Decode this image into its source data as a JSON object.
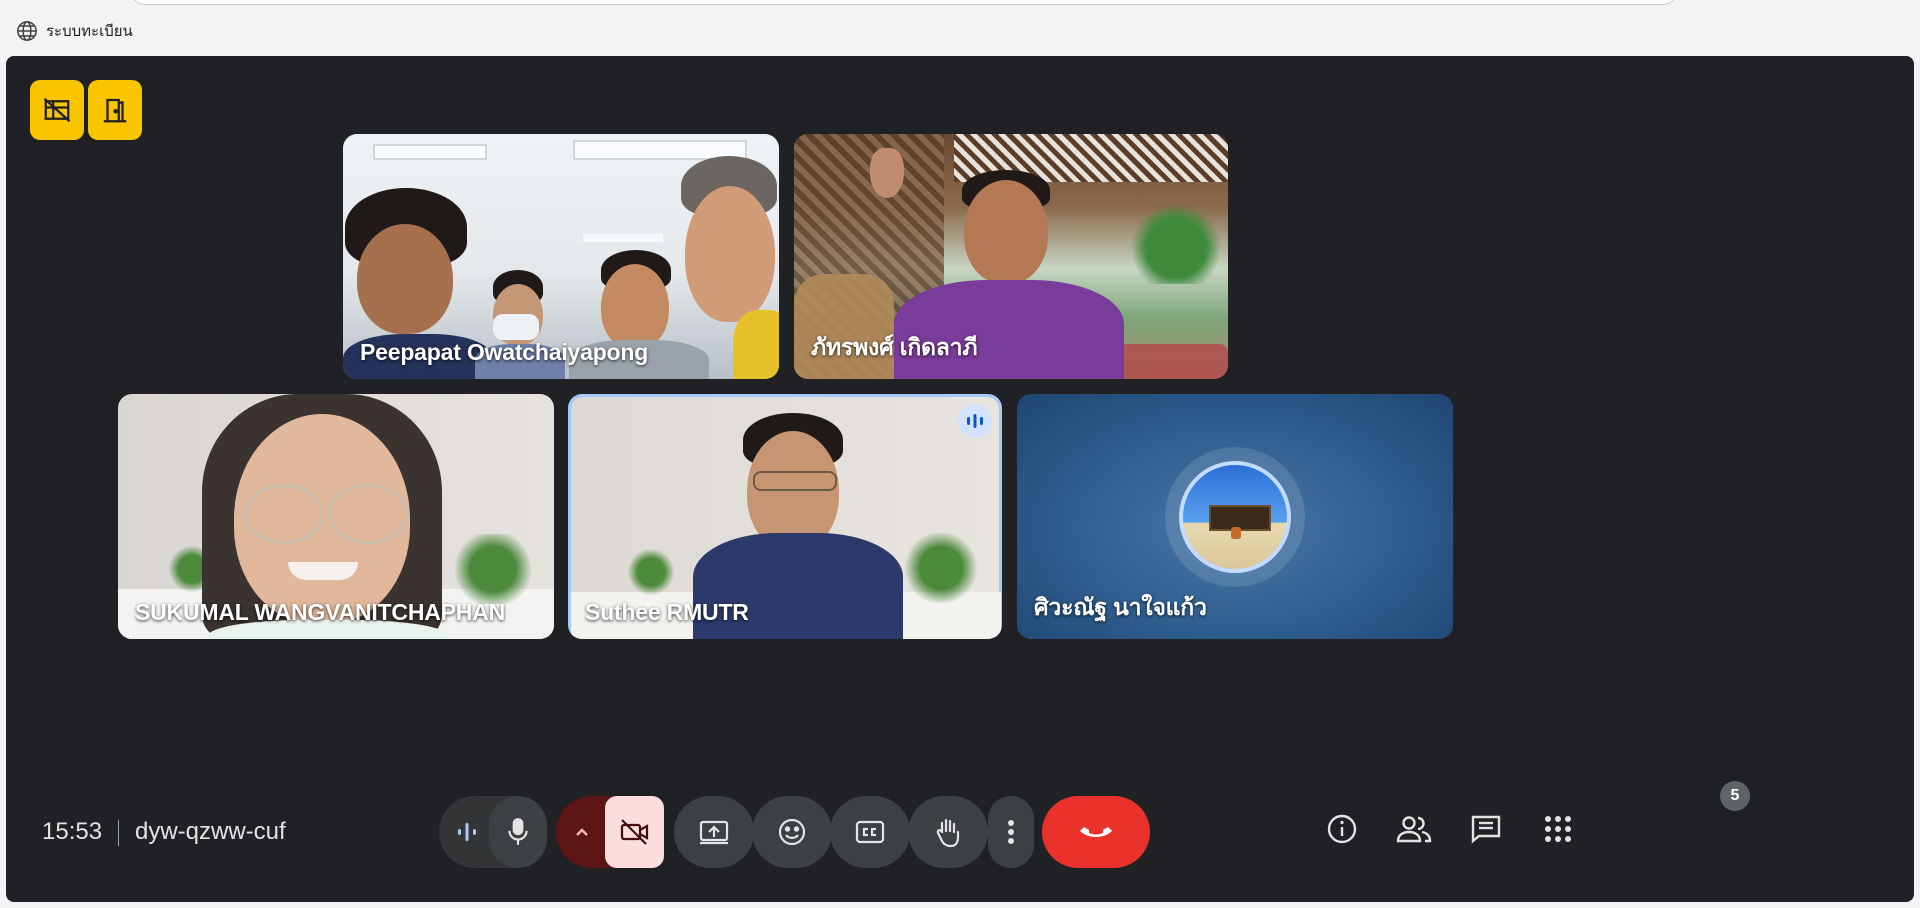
{
  "browser": {
    "site_label": "ระบบทะเบียน",
    "site_icon": "globe-icon"
  },
  "meeting": {
    "time": "15:53",
    "code": "dyw-qzww-cuf",
    "people_count": "5",
    "corner_buttons": [
      "hide-tiles-icon",
      "leave-room-icon"
    ]
  },
  "participants": [
    {
      "name": "Peepapat Owatchaiyapong",
      "speaking": false
    },
    {
      "name": "ภัทรพงศ์ เกิดลาภี",
      "speaking": false
    },
    {
      "name": "SUKUMAL WANGVANITCHAPHAN",
      "speaking": false
    },
    {
      "name": "Suthee RMUTR",
      "speaking": true
    },
    {
      "name": "ศิวะณัฐ นาใจแก้ว",
      "speaking": false,
      "camera_off": true
    }
  ],
  "controls": {
    "mic": "microphone-icon",
    "camera": "camera-off-icon",
    "share": "present-screen-icon",
    "emoji": "emoji-icon",
    "captions": "captions-icon",
    "raise_hand": "raise-hand-icon",
    "more": "more-options-icon",
    "leave": "end-call-icon",
    "info": "info-icon",
    "people": "people-icon",
    "chat": "chat-icon",
    "activities": "activities-icon"
  },
  "colors": {
    "accent_yellow": "#f9c400",
    "end_call_red": "#e8322b",
    "camera_off_bg": "#f9dedc",
    "stage_bg": "#202124",
    "active_border": "#a8c7fa"
  }
}
